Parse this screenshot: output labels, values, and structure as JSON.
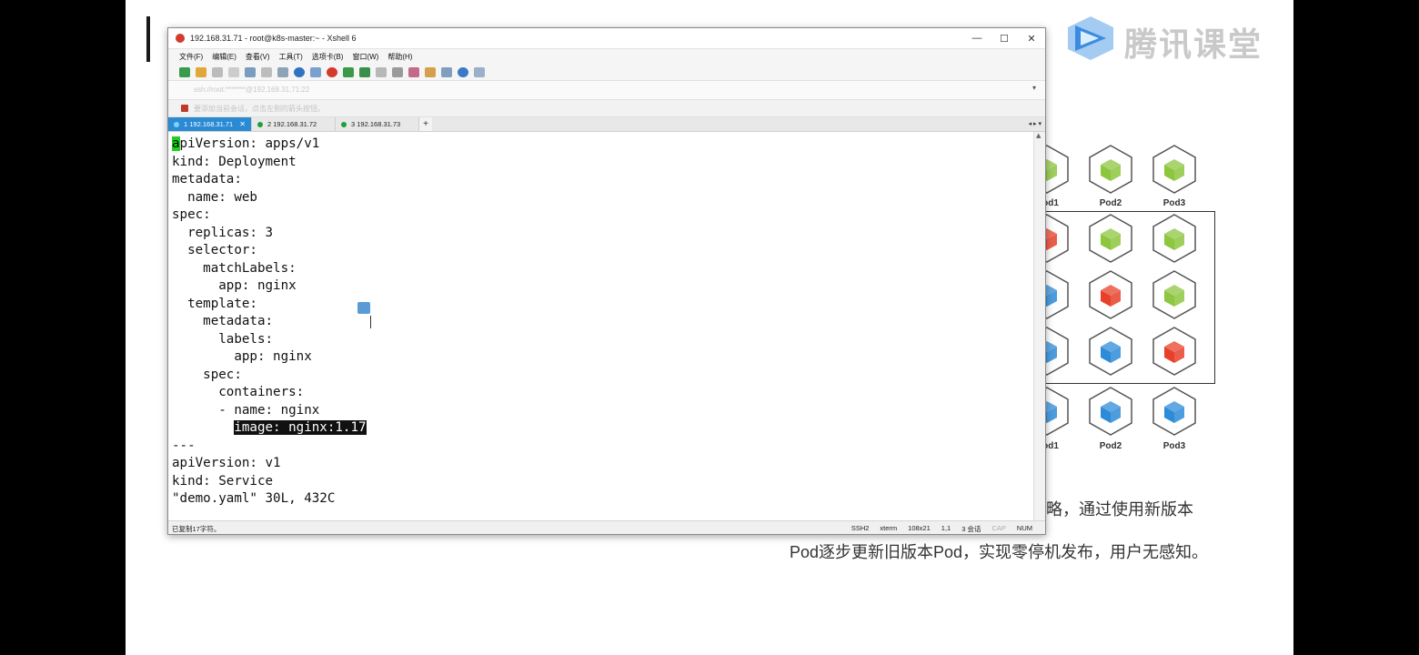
{
  "slide": {
    "logo_text": "腾讯课堂",
    "caption_line1": "策略，通过使用新版本",
    "caption_line2": "Pod逐步更新旧版本Pod，实现零停机发布，用户无感知。",
    "pod_labels": [
      "od1",
      "Pod2",
      "Pod3",
      "od1",
      "Pod2",
      "Pod3"
    ],
    "pod_colors": {
      "green": "#8dc63f",
      "red": "#e8412b",
      "blue": "#2e8bd8"
    }
  },
  "window": {
    "title": "192.168.31.71 - root@k8s-master:~ - Xshell 6",
    "controls": [
      "—",
      "☐",
      "✕"
    ],
    "menu": [
      "文件(F)",
      "编辑(E)",
      "查看(V)",
      "工具(T)",
      "选项卡(B)",
      "窗口(W)",
      "帮助(H)"
    ],
    "address": "ssh://root:*******@192.168.31.71:22",
    "hint": "要添加当前会话，点击左侧的箭头按钮。",
    "tabs": [
      {
        "label": "1 192.168.31.71",
        "active": true
      },
      {
        "label": "2 192.168.31.72",
        "active": false
      },
      {
        "label": "3 192.168.31.73",
        "active": false
      }
    ],
    "tab_add": "+",
    "terminal_lines": [
      "apiVersion: apps/v1",
      "kind: Deployment",
      "metadata:",
      "  name: web",
      "spec:",
      "  replicas: 3",
      "  selector:",
      "    matchLabels:",
      "      app: nginx",
      "  template:",
      "    metadata:",
      "      labels:",
      "        app: nginx",
      "    spec:",
      "      containers:",
      "      - name: nginx",
      "        image: nginx:1.17",
      "---",
      "apiVersion: v1",
      "kind: Service",
      "\"demo.yaml\" 30L, 432C"
    ],
    "cursor_char": "a",
    "selected_text": "image: nginx:1.17",
    "status": {
      "left": "已复制17字符。",
      "protocol": "SSH2",
      "term": "xterm",
      "size": "108x21",
      "pos": "1,1",
      "sessions": "3 会话",
      "cap": "CAP",
      "num": "NUM"
    }
  }
}
